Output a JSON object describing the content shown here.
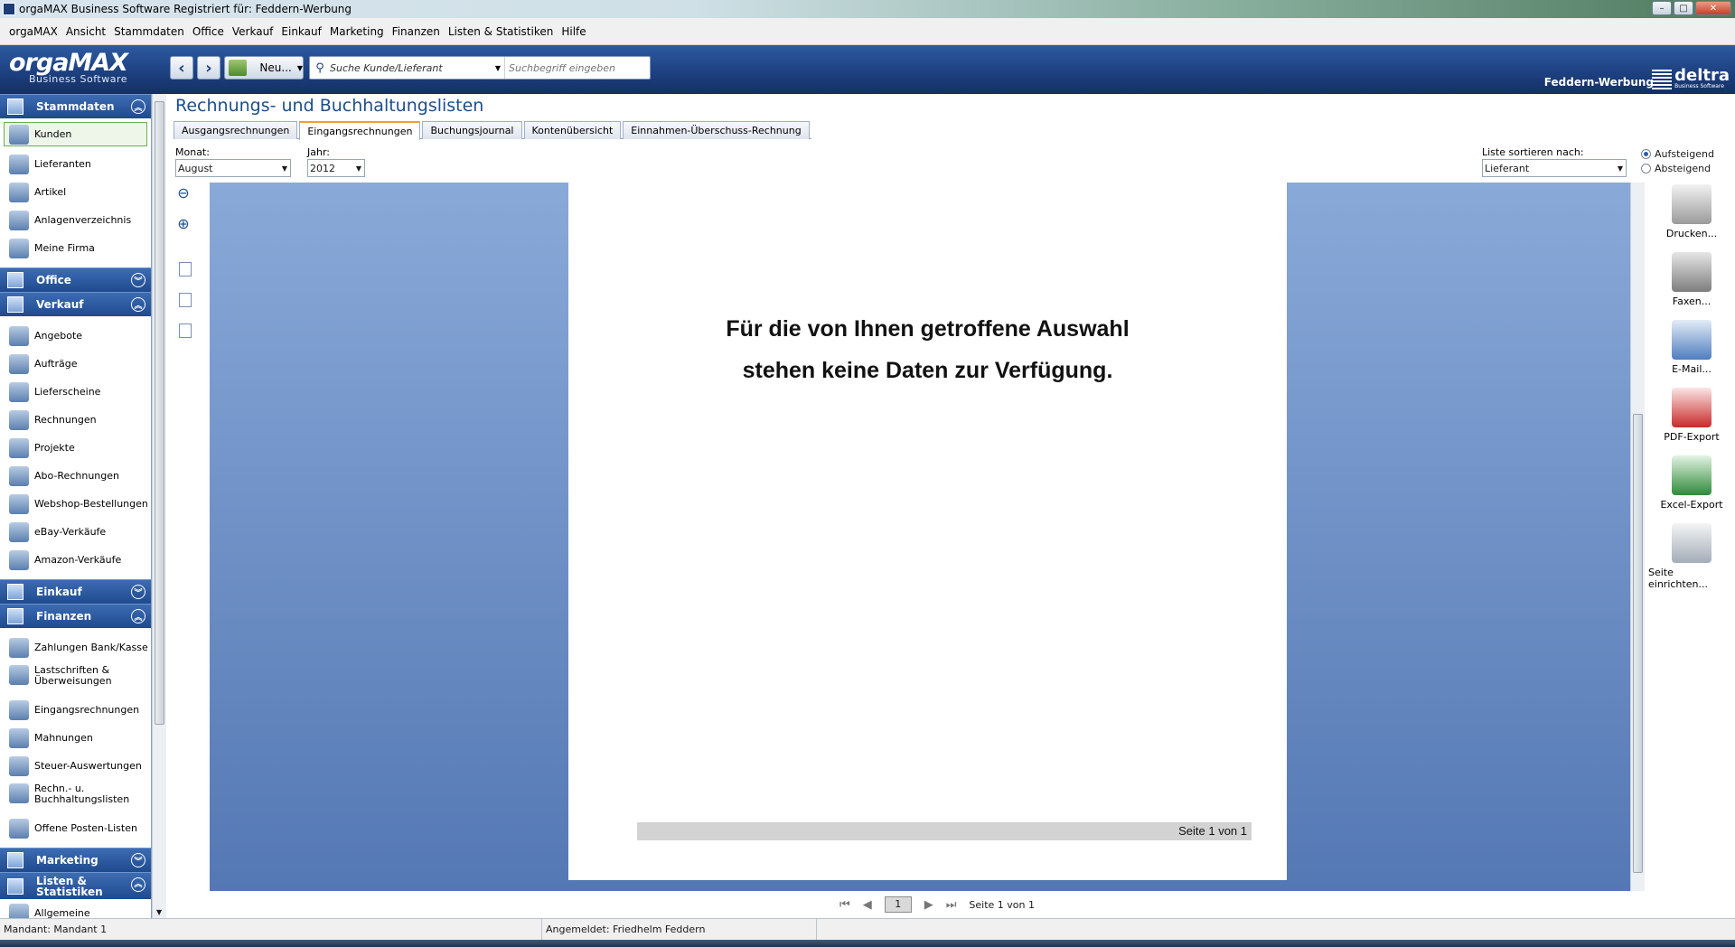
{
  "window": {
    "title": "orgaMAX Business Software Registriert für: Feddern-Werbung",
    "controls": {
      "minimize": "–",
      "maximize": "□",
      "close": "✕"
    }
  },
  "menu": [
    "orgaMAX",
    "Ansicht",
    "Stammdaten",
    "Office",
    "Verkauf",
    "Einkauf",
    "Marketing",
    "Finanzen",
    "Listen & Statistiken",
    "Hilfe"
  ],
  "toolbar": {
    "logo_brand": "orgaMAX",
    "logo_sub": "Business Software",
    "back_icon": "‹",
    "forward_icon": "›",
    "new_label": "Neu...",
    "search_category": "Suche Kunde/Lieferant",
    "search_placeholder": "Suchbegriff eingeben",
    "company": "Feddern-Werbung",
    "vendor_logo": "deltra",
    "vendor_sub": "Business Software"
  },
  "sidebar": {
    "stammdaten": {
      "title": "Stammdaten",
      "chevron": "︽",
      "items": [
        "Kunden",
        "Lieferanten",
        "Artikel",
        "Anlagenverzeichnis",
        "Meine Firma"
      ]
    },
    "office": {
      "title": "Office",
      "chevron": "︾"
    },
    "verkauf": {
      "title": "Verkauf",
      "chevron": "︽",
      "items": [
        "Angebote",
        "Aufträge",
        "Lieferscheine",
        "Rechnungen",
        "Projekte",
        "Abo-Rechnungen",
        "Webshop-Bestellungen",
        "eBay-Verkäufe",
        "Amazon-Verkäufe"
      ]
    },
    "einkauf": {
      "title": "Einkauf",
      "chevron": "︾"
    },
    "finanzen": {
      "title": "Finanzen",
      "chevron": "︽",
      "items": [
        "Zahlungen Bank/Kasse",
        "Lastschriften & Überweisungen",
        "Eingangsrechnungen",
        "Mahnungen",
        "Steuer-Auswertungen",
        "Rechn.- u. Buchhaltungslisten",
        "Offene Posten-Listen"
      ]
    },
    "marketing": {
      "title": "Marketing",
      "chevron": "︾"
    },
    "listen": {
      "title": "Listen & Statistiken",
      "chevron": "︽",
      "items": [
        "Allgemeine"
      ]
    }
  },
  "main": {
    "title": "Rechnungs- und Buchhaltungslisten",
    "tabs": [
      "Ausgangsrechnungen",
      "Eingangsrechnungen",
      "Buchungsjournal",
      "Kontenübersicht",
      "Einnahmen-Überschuss-Rechnung"
    ],
    "active_tab": "Eingangsrechnungen",
    "month_label": "Monat:",
    "month_value": "August",
    "year_label": "Jahr:",
    "year_value": "2012",
    "sort_label": "Liste sortieren nach:",
    "sort_value": "Lieferant",
    "sort_asc": "Aufsteigend",
    "sort_desc": "Absteigend",
    "zoom_out_icon": "⊖",
    "zoom_in_icon": "⊕",
    "message_line1": "Für die von Ihnen getroffene Auswahl",
    "message_line2": "stehen keine Daten zur Verfügung.",
    "page_footer": "Seite 1 von 1",
    "actions": [
      "Drucken...",
      "Faxen...",
      "E-Mail...",
      "PDF-Export",
      "Excel-Export",
      "Seite einrichten..."
    ],
    "pager": {
      "first": "⏮",
      "prev": "◀",
      "page": "1",
      "next": "▶",
      "last": "⏭",
      "text": "Seite 1 von 1"
    }
  },
  "statusbar": {
    "mandant": "Mandant: Mandant 1",
    "user": "Angemeldet: Friedhelm Feddern"
  },
  "colors": {
    "accent": "#1d4e8c",
    "header": "#1f4a8e",
    "preview_bg": "#6e90c6"
  }
}
